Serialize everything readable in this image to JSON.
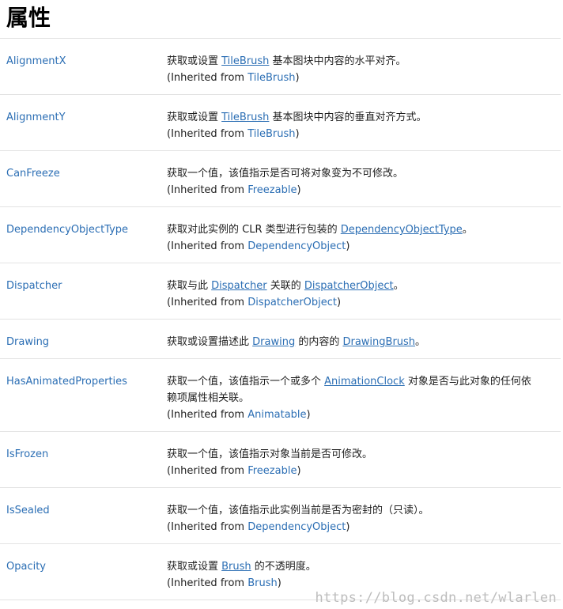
{
  "page": {
    "title": "属性",
    "watermark": "https://blog.csdn.net/wlarlen"
  },
  "inherited": {
    "prefix": "(Inherited from ",
    "suffix": ")"
  },
  "properties": [
    {
      "name": "AlignmentX",
      "desc": [
        "获取或设置 ",
        "TileBrush",
        " 基本图块中内容的水平对齐。"
      ],
      "inherited_from": "TileBrush"
    },
    {
      "name": "AlignmentY",
      "desc": [
        "获取或设置 ",
        "TileBrush",
        " 基本图块中内容的垂直对齐方式。"
      ],
      "inherited_from": "TileBrush"
    },
    {
      "name": "CanFreeze",
      "desc": [
        "获取一个值，该值指示是否可将对象变为不可修改。"
      ],
      "inherited_from": "Freezable"
    },
    {
      "name": "DependencyObjectType",
      "desc": [
        "获取对此实例的 CLR 类型进行包装的 ",
        "DependencyObjectType",
        "。"
      ],
      "inherited_from": "DependencyObject"
    },
    {
      "name": "Dispatcher",
      "desc": [
        "获取与此 ",
        "Dispatcher",
        " 关联的 ",
        "DispatcherObject",
        "。"
      ],
      "inherited_from": "DispatcherObject"
    },
    {
      "name": "Drawing",
      "desc": [
        "获取或设置描述此 ",
        "Drawing",
        " 的内容的 ",
        "DrawingBrush",
        "。"
      ]
    },
    {
      "name": "HasAnimatedProperties",
      "desc": [
        "获取一个值，该值指示一个或多个 ",
        "AnimationClock",
        " 对象是否与此对象的任何依"
      ],
      "desc_line2": "赖项属性相关联。",
      "inherited_from": "Animatable"
    },
    {
      "name": "IsFrozen",
      "desc": [
        "获取一个值，该值指示对象当前是否可修改。"
      ],
      "inherited_from": "Freezable"
    },
    {
      "name": "IsSealed",
      "desc": [
        "获取一个值，该值指示此实例当前是否为密封的（只读）。"
      ],
      "inherited_from": "DependencyObject"
    },
    {
      "name": "Opacity",
      "desc": [
        "获取或设置 ",
        "Brush",
        " 的不透明度。"
      ],
      "inherited_from": "Brush"
    }
  ]
}
